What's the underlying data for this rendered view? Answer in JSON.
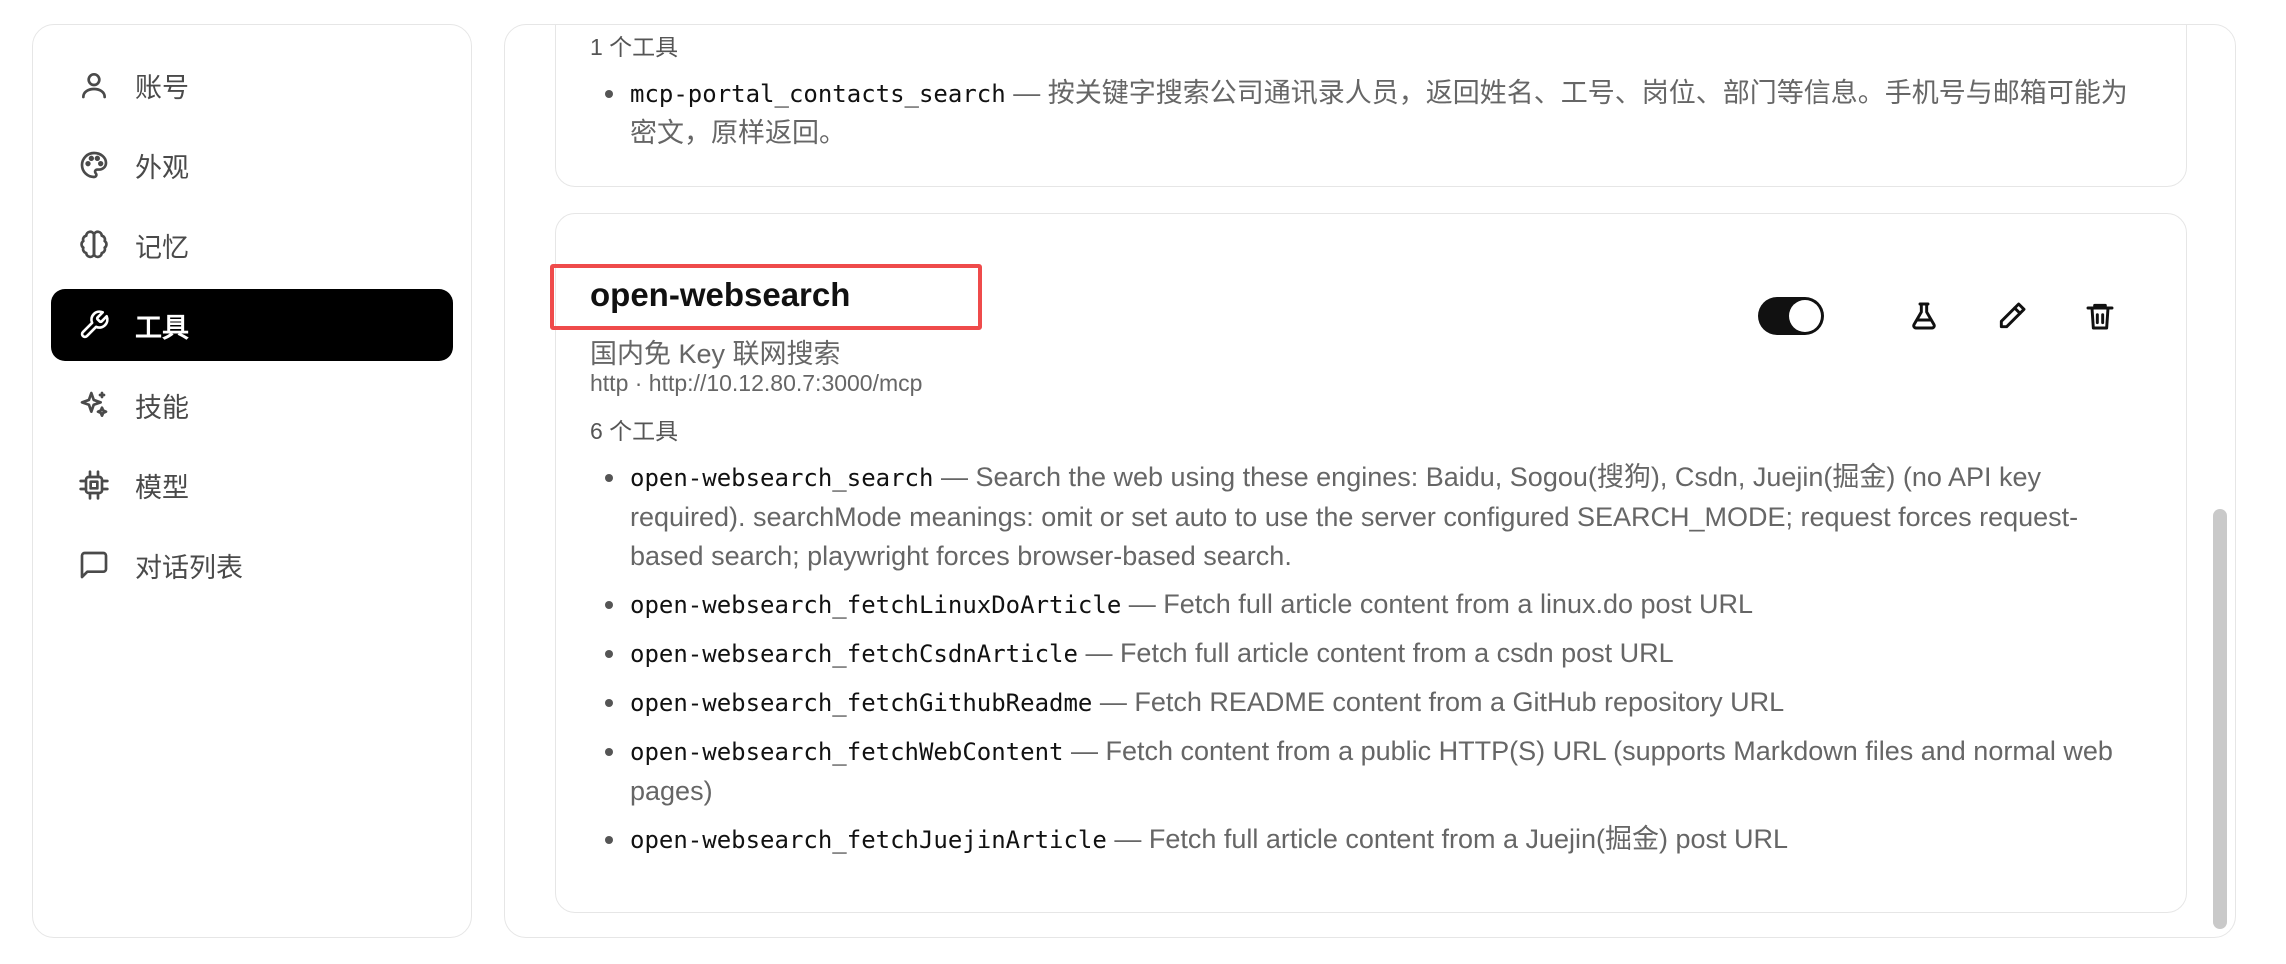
{
  "sidebar": {
    "items": [
      {
        "label": "账号",
        "icon": "user-icon",
        "active": false
      },
      {
        "label": "外观",
        "icon": "palette-icon",
        "active": false
      },
      {
        "label": "记忆",
        "icon": "brain-icon",
        "active": false
      },
      {
        "label": "工具",
        "icon": "wrench-icon",
        "active": true
      },
      {
        "label": "技能",
        "icon": "sparkles-icon",
        "active": false
      },
      {
        "label": "模型",
        "icon": "cpu-icon",
        "active": false
      },
      {
        "label": "对话列表",
        "icon": "message-square-icon",
        "active": false
      }
    ]
  },
  "previous_server": {
    "tool_count": "1 个工具",
    "tools": [
      {
        "name": "mcp-portal_contacts_search",
        "description": " — 按关键字搜索公司通讯录人员，返回姓名、工号、岗位、部门等信息。手机号与邮箱可能为密文，原样返回。"
      }
    ]
  },
  "server": {
    "name": "open-websearch",
    "description": "国内免 Key 联网搜索",
    "url_line": "http · http://10.12.80.7:3000/mcp",
    "enabled": true,
    "tool_count": "6 个工具",
    "tools": [
      {
        "name": "open-websearch_search",
        "description": " — Search the web using these engines: Baidu, Sogou(搜狗), Csdn, Juejin(掘金) (no API key required). searchMode meanings: omit or set auto to use the server configured SEARCH_MODE; request forces request-based search; playwright forces browser-based search."
      },
      {
        "name": "open-websearch_fetchLinuxDoArticle",
        "description": " — Fetch full article content from a linux.do post URL"
      },
      {
        "name": "open-websearch_fetchCsdnArticle",
        "description": " — Fetch full article content from a csdn post URL"
      },
      {
        "name": "open-websearch_fetchGithubReadme",
        "description": " — Fetch README content from a GitHub repository URL"
      },
      {
        "name": "open-websearch_fetchWebContent",
        "description": " — Fetch content from a public HTTP(S) URL (supports Markdown files and normal web pages)"
      },
      {
        "name": "open-websearch_fetchJuejinArticle",
        "description": " — Fetch full article content from a Juejin(掘金) post URL"
      }
    ]
  },
  "colors": {
    "highlight_border": "#ef4b4b",
    "active_nav_bg": "#000000"
  }
}
